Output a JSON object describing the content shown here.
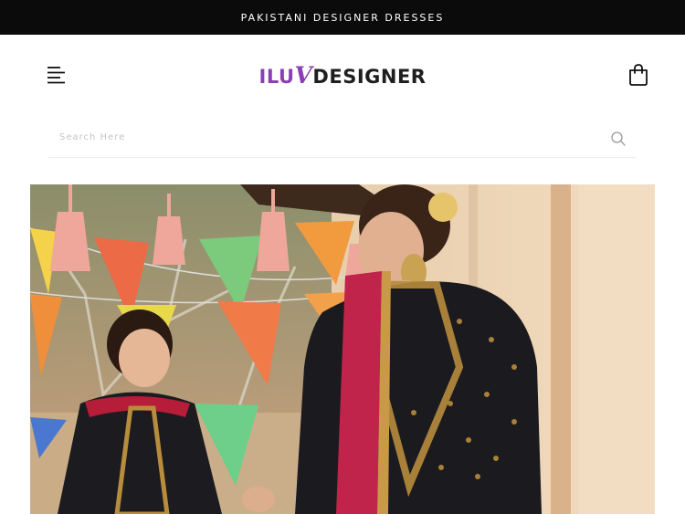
{
  "announcement": {
    "text": "PAKISTANI DESIGNER DRESSES"
  },
  "header": {
    "logo": {
      "part1": "ILU",
      "part2": "V",
      "part3": "DESIGNER"
    }
  },
  "search": {
    "placeholder": "Search Here"
  },
  "icons": {
    "menu": "hamburger-menu-icon",
    "cart": "shopping-bag-icon",
    "search": "search-icon"
  },
  "colors": {
    "topbar": "#0b0b0b",
    "logo_accent": "#8a3fb5",
    "logo_text": "#1f1f1f"
  }
}
